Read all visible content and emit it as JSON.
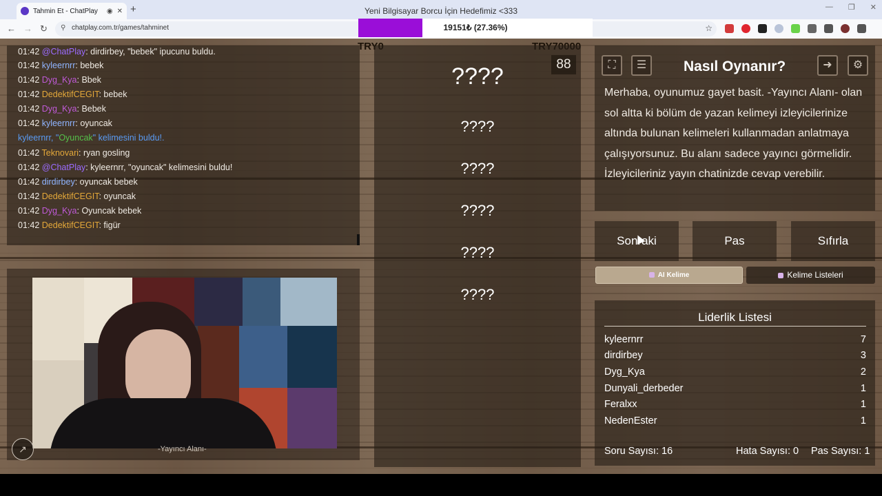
{
  "browser": {
    "tab_title": "Tahmin Et - ChatPlay",
    "window_title": "Yeni Bilgisayar Borcu İçin Hedefimiz <333",
    "url": "chatplay.com.tr/games/tahminet"
  },
  "donation": {
    "text": "19151₺ (27.36%)",
    "progress_fraction": 0.2736,
    "left_label": "TRY0",
    "right_label": "TRY70000",
    "fill_color": "#9a0ed8"
  },
  "chat": {
    "lines": [
      {
        "ts": "01:42",
        "user": "@ChatPlay",
        "user_color": "#9b6bff",
        "msg": ": dirdirbey, \"bebek\" ipucunu buldu."
      },
      {
        "ts": "01:42",
        "user": "kyleernrr",
        "user_color": "#8fb4ff",
        "msg": ": bebek"
      },
      {
        "ts": "01:42",
        "user": "Dyg_Kya",
        "user_color": "#c05ad8",
        "msg": ": Bbek"
      },
      {
        "ts": "01:42",
        "user": "DedektifCEGIT",
        "user_color": "#e5a93a",
        "msg": ": bebek"
      },
      {
        "ts": "01:42",
        "user": "Dyg_Kya",
        "user_color": "#c05ad8",
        "msg": ": Bebek"
      },
      {
        "ts": "01:42",
        "user": "kyleernrr",
        "user_color": "#8fb4ff",
        "msg": ": oyuncak"
      },
      {
        "ts": "01:42",
        "user": "Teknovari",
        "user_color": "#e5a93a",
        "msg": ": ryan gosling"
      },
      {
        "ts": "01:42",
        "user": "@ChatPlay",
        "user_color": "#9b6bff",
        "msg": ": kyleernrr, \"oyuncak\" kelimesini buldu!"
      },
      {
        "ts": "01:42",
        "user": "dirdirbey",
        "user_color": "#8fb4ff",
        "msg": ": oyuncak bebek"
      },
      {
        "ts": "01:42",
        "user": "DedektifCEGIT",
        "user_color": "#e5a93a",
        "msg": ": oyuncak"
      },
      {
        "ts": "01:42",
        "user": "Dyg_Kya",
        "user_color": "#c05ad8",
        "msg": ": Oyuncak bebek"
      },
      {
        "ts": "01:42",
        "user": "DedektifCEGIT",
        "user_color": "#e5a93a",
        "msg": ": figür"
      }
    ],
    "system_line": {
      "part1": "kyleernrr, \"",
      "word": "Oyuncak",
      "part2": "\" kelimesini buldu!."
    }
  },
  "camera": {
    "label": "-Yayıncı Alanı-"
  },
  "game": {
    "timer": "88",
    "words": [
      "????",
      "????",
      "????",
      "????",
      "????",
      "????"
    ]
  },
  "info": {
    "title": "Nasıl Oynanır?",
    "text": "Merhaba, oyunumuz gayet basit. -Yayıncı Alanı- olan sol altta ki bölüm de yazan kelimeyi izleyicilerinize altında bulunan kelimeleri kullanmadan anlatmaya çalışıyorsunuz. Bu alanı sadece yayıncı görmelidir. İzleyicileriniz yayın chatinizde cevap verebilir."
  },
  "actions": {
    "next": "Sonraki",
    "pass": "Pas",
    "reset": "Sıfırla",
    "ai_word": "AI Kelime",
    "word_lists": "Kelime Listeleri"
  },
  "leaderboard": {
    "title": "Liderlik Listesi",
    "rows": [
      {
        "name": "kyleernrr",
        "score": "7"
      },
      {
        "name": "dirdirbey",
        "score": "3"
      },
      {
        "name": "Dyg_Kya",
        "score": "2"
      },
      {
        "name": "Dunyali_derbeder",
        "score": "1"
      },
      {
        "name": "Feralxx",
        "score": "1"
      },
      {
        "name": "NedenEster",
        "score": "1"
      }
    ]
  },
  "stats": {
    "questions": "Soru Sayısı: 16",
    "errors": "Hata Sayısı: 0",
    "passes": "Pas Sayısı: 1"
  }
}
